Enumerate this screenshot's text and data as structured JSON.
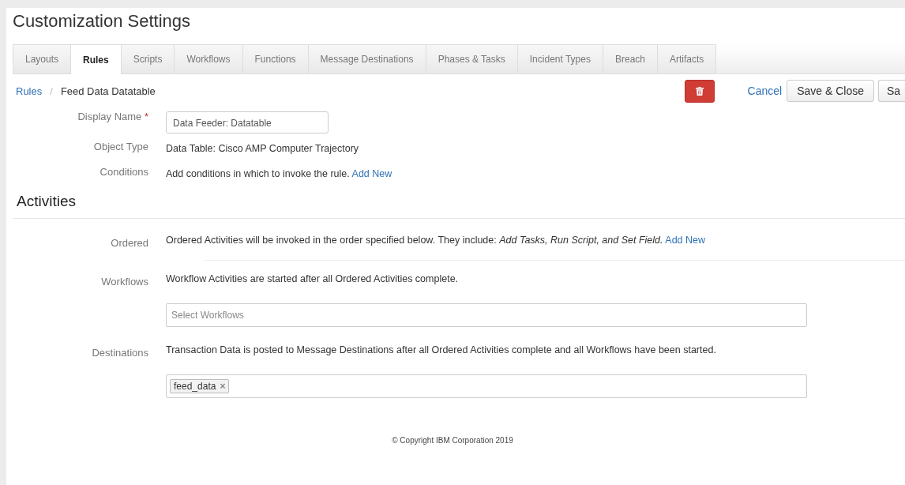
{
  "title": "Customization Settings",
  "tabs": [
    {
      "label": "Layouts",
      "selected": false
    },
    {
      "label": "Rules",
      "selected": true
    },
    {
      "label": "Scripts",
      "selected": false
    },
    {
      "label": "Workflows",
      "selected": false
    },
    {
      "label": "Functions",
      "selected": false
    },
    {
      "label": "Message Destinations",
      "selected": false
    },
    {
      "label": "Phases & Tasks",
      "selected": false
    },
    {
      "label": "Incident Types",
      "selected": false
    },
    {
      "label": "Breach",
      "selected": false
    },
    {
      "label": "Artifacts",
      "selected": false
    }
  ],
  "breadcrumb": {
    "link": "Rules",
    "separator": "/",
    "current": "Feed Data Datatable"
  },
  "actions": {
    "cancel": "Cancel",
    "save_close": "Save & Close",
    "save": "Sa"
  },
  "form": {
    "display_name": {
      "label": "Display Name",
      "required_mark": "*",
      "value": "Data Feeder: Datatable"
    },
    "object_type": {
      "label": "Object Type",
      "value": "Data Table: Cisco AMP Computer Trajectory"
    },
    "conditions": {
      "label": "Conditions",
      "text": "Add conditions in which to invoke the rule.",
      "link": "Add New"
    }
  },
  "activities": {
    "heading": "Activities",
    "ordered": {
      "label": "Ordered",
      "text": "Ordered Activities will be invoked in the order specified below. They include: *Add Tasks, Run Script, and Set Field.*",
      "link": "Add New"
    },
    "workflows": {
      "label": "Workflows",
      "text": "Workflow Activities are started after all Ordered Activities complete.",
      "placeholder": "Select Workflows"
    },
    "destinations": {
      "label": "Destinations",
      "text": "Transaction Data is posted to Message Destinations after all Ordered Activities complete and all Workflows have been started.",
      "tags": [
        {
          "label": "feed_data",
          "remove": "×"
        }
      ]
    }
  },
  "footer": "© Copyright IBM Corporation 2019"
}
